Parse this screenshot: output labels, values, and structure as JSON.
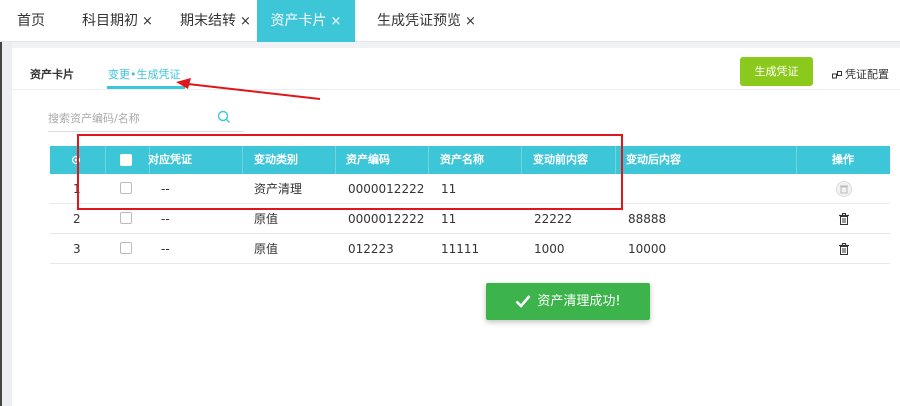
{
  "tabs": [
    {
      "label": "首页",
      "closable": false
    },
    {
      "label": "科目期初",
      "closable": true
    },
    {
      "label": "期末结转",
      "closable": true
    },
    {
      "label": "资产卡片",
      "closable": true,
      "active": true
    },
    {
      "label": "生成凭证预览",
      "closable": true
    }
  ],
  "close_glyph": "×",
  "subtabs": [
    {
      "label": "资产卡片"
    },
    {
      "label": "变更•生成凭证",
      "active": true
    }
  ],
  "toolbar": {
    "generate_label": "生成凭证",
    "config_label": "凭证配置",
    "config_icon": "link-icon"
  },
  "search": {
    "placeholder": "搜索资产编码/名称",
    "icon": "search-icon"
  },
  "table": {
    "headers": [
      "对应凭证",
      "变动类别",
      "资产编码",
      "资产名称",
      "变动前内容",
      "变动后内容",
      "操作"
    ],
    "header_gear_icon": "gear-icon",
    "rows": [
      {
        "index": "1",
        "voucher": "--",
        "type": "资产清理",
        "code": "0000012222",
        "name": "11",
        "before": "",
        "after": "",
        "action_icon": "trash-icon",
        "action_disabled": true
      },
      {
        "index": "2",
        "voucher": "--",
        "type": "原值",
        "code": "0000012222",
        "name": "11",
        "before": "22222",
        "after": "88888",
        "action_icon": "trash-icon",
        "action_disabled": false
      },
      {
        "index": "3",
        "voucher": "--",
        "type": "原值",
        "code": "012223",
        "name": "11111",
        "before": "1000",
        "after": "10000",
        "action_icon": "trash-icon",
        "action_disabled": false
      }
    ]
  },
  "toast": {
    "message": "资产清理成功!",
    "icon": "check-icon"
  },
  "colors": {
    "accent": "#3dc5d8",
    "generate_button": "#8cc91d",
    "toast_bg": "#3cb44b",
    "annotation_red": "#e0161b"
  }
}
